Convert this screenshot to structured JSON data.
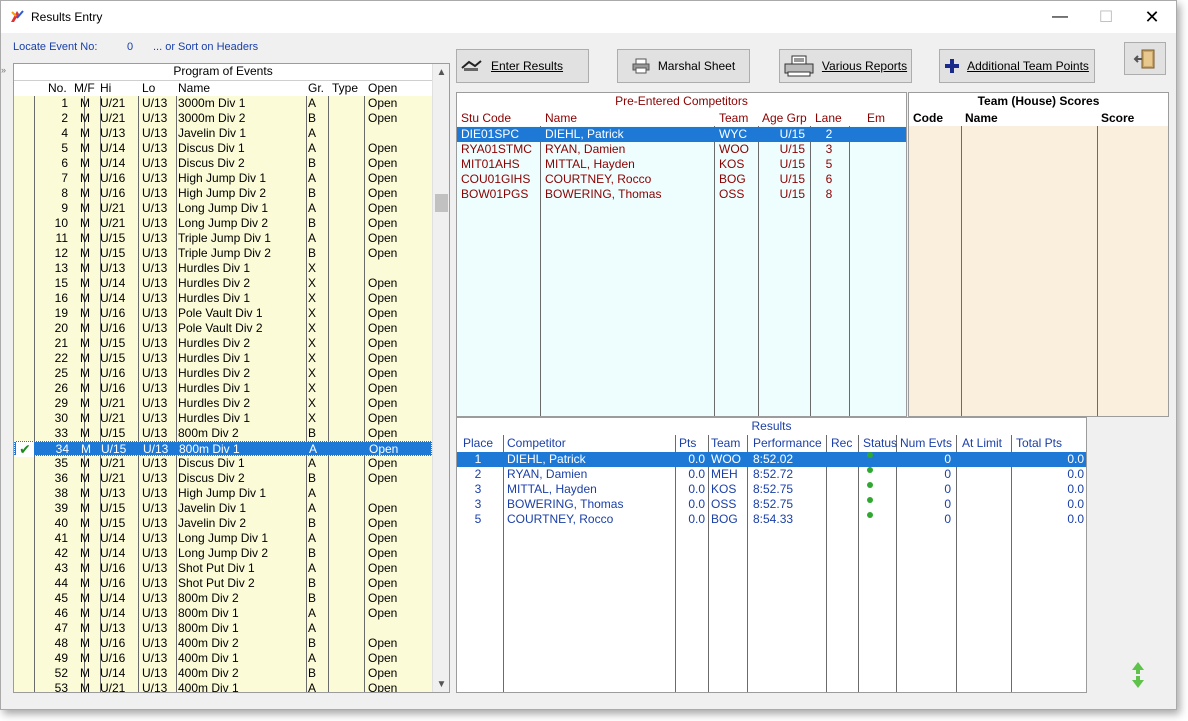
{
  "window": {
    "title": "Results Entry",
    "minimize": "—",
    "maximize": "☐",
    "close": "✕"
  },
  "locate": {
    "label": "Locate Event No:",
    "value": "0",
    "sort_hint": "... or Sort on Headers"
  },
  "program": {
    "title": "Program of Events",
    "headers": {
      "no": "No.",
      "mf": "M/F",
      "hi": "Hi",
      "lo": "Lo",
      "name": "Name",
      "gr": "Gr.",
      "type": "Type",
      "open": "Open"
    },
    "rows": [
      {
        "no": "1",
        "mf": "M",
        "hi": "U/21",
        "lo": "U/13",
        "name": "3000m Div 1",
        "gr": "A",
        "type": "",
        "open": "Open"
      },
      {
        "no": "2",
        "mf": "M",
        "hi": "U/21",
        "lo": "U/13",
        "name": "3000m Div 2",
        "gr": "B",
        "type": "",
        "open": "Open"
      },
      {
        "no": "4",
        "mf": "M",
        "hi": "U/13",
        "lo": "U/13",
        "name": "Javelin Div 1",
        "gr": "A",
        "type": "",
        "open": ""
      },
      {
        "no": "5",
        "mf": "M",
        "hi": "U/14",
        "lo": "U/13",
        "name": "Discus Div 1",
        "gr": "A",
        "type": "",
        "open": "Open"
      },
      {
        "no": "6",
        "mf": "M",
        "hi": "U/14",
        "lo": "U/13",
        "name": "Discus Div 2",
        "gr": "B",
        "type": "",
        "open": "Open"
      },
      {
        "no": "7",
        "mf": "M",
        "hi": "U/16",
        "lo": "U/13",
        "name": "High Jump Div 1",
        "gr": "A",
        "type": "",
        "open": "Open"
      },
      {
        "no": "8",
        "mf": "M",
        "hi": "U/16",
        "lo": "U/13",
        "name": "High Jump Div 2",
        "gr": "B",
        "type": "",
        "open": "Open"
      },
      {
        "no": "9",
        "mf": "M",
        "hi": "U/21",
        "lo": "U/13",
        "name": "Long Jump Div 1",
        "gr": "A",
        "type": "",
        "open": "Open"
      },
      {
        "no": "10",
        "mf": "M",
        "hi": "U/21",
        "lo": "U/13",
        "name": "Long Jump Div 2",
        "gr": "B",
        "type": "",
        "open": "Open"
      },
      {
        "no": "11",
        "mf": "M",
        "hi": "U/15",
        "lo": "U/13",
        "name": "Triple Jump Div 1",
        "gr": "A",
        "type": "",
        "open": "Open"
      },
      {
        "no": "12",
        "mf": "M",
        "hi": "U/15",
        "lo": "U/13",
        "name": "Triple Jump Div 2",
        "gr": "B",
        "type": "",
        "open": "Open"
      },
      {
        "no": "13",
        "mf": "M",
        "hi": "U/13",
        "lo": "U/13",
        "name": "Hurdles Div 1",
        "gr": "X",
        "type": "",
        "open": ""
      },
      {
        "no": "15",
        "mf": "M",
        "hi": "U/14",
        "lo": "U/13",
        "name": "Hurdles Div 2",
        "gr": "X",
        "type": "",
        "open": "Open"
      },
      {
        "no": "16",
        "mf": "M",
        "hi": "U/14",
        "lo": "U/13",
        "name": "Hurdles Div 1",
        "gr": "X",
        "type": "",
        "open": "Open"
      },
      {
        "no": "19",
        "mf": "M",
        "hi": "U/16",
        "lo": "U/13",
        "name": "Pole Vault Div 1",
        "gr": "X",
        "type": "",
        "open": "Open"
      },
      {
        "no": "20",
        "mf": "M",
        "hi": "U/16",
        "lo": "U/13",
        "name": "Pole Vault Div 2",
        "gr": "X",
        "type": "",
        "open": "Open"
      },
      {
        "no": "21",
        "mf": "M",
        "hi": "U/15",
        "lo": "U/13",
        "name": "Hurdles Div 2",
        "gr": "X",
        "type": "",
        "open": "Open"
      },
      {
        "no": "22",
        "mf": "M",
        "hi": "U/15",
        "lo": "U/13",
        "name": "Hurdles Div 1",
        "gr": "X",
        "type": "",
        "open": "Open"
      },
      {
        "no": "25",
        "mf": "M",
        "hi": "U/16",
        "lo": "U/13",
        "name": "Hurdles Div 2",
        "gr": "X",
        "type": "",
        "open": "Open"
      },
      {
        "no": "26",
        "mf": "M",
        "hi": "U/16",
        "lo": "U/13",
        "name": "Hurdles Div 1",
        "gr": "X",
        "type": "",
        "open": "Open"
      },
      {
        "no": "29",
        "mf": "M",
        "hi": "U/21",
        "lo": "U/13",
        "name": "Hurdles Div 2",
        "gr": "X",
        "type": "",
        "open": "Open"
      },
      {
        "no": "30",
        "mf": "M",
        "hi": "U/21",
        "lo": "U/13",
        "name": "Hurdles Div 1",
        "gr": "X",
        "type": "",
        "open": "Open"
      },
      {
        "no": "33",
        "mf": "M",
        "hi": "U/15",
        "lo": "U/13",
        "name": "800m Div 2",
        "gr": "B",
        "type": "",
        "open": "Open"
      },
      {
        "no": "34",
        "mf": "M",
        "hi": "U/15",
        "lo": "U/13",
        "name": "800m Div 1",
        "gr": "A",
        "type": "",
        "open": "Open",
        "selected": true
      },
      {
        "no": "35",
        "mf": "M",
        "hi": "U/21",
        "lo": "U/13",
        "name": "Discus Div 1",
        "gr": "A",
        "type": "",
        "open": "Open"
      },
      {
        "no": "36",
        "mf": "M",
        "hi": "U/21",
        "lo": "U/13",
        "name": "Discus Div 2",
        "gr": "B",
        "type": "",
        "open": "Open"
      },
      {
        "no": "38",
        "mf": "M",
        "hi": "U/13",
        "lo": "U/13",
        "name": "High Jump Div 1",
        "gr": "A",
        "type": "",
        "open": ""
      },
      {
        "no": "39",
        "mf": "M",
        "hi": "U/15",
        "lo": "U/13",
        "name": "Javelin Div 1",
        "gr": "A",
        "type": "",
        "open": "Open"
      },
      {
        "no": "40",
        "mf": "M",
        "hi": "U/15",
        "lo": "U/13",
        "name": "Javelin Div 2",
        "gr": "B",
        "type": "",
        "open": "Open"
      },
      {
        "no": "41",
        "mf": "M",
        "hi": "U/14",
        "lo": "U/13",
        "name": "Long Jump Div 1",
        "gr": "A",
        "type": "",
        "open": "Open"
      },
      {
        "no": "42",
        "mf": "M",
        "hi": "U/14",
        "lo": "U/13",
        "name": "Long Jump Div 2",
        "gr": "B",
        "type": "",
        "open": "Open"
      },
      {
        "no": "43",
        "mf": "M",
        "hi": "U/16",
        "lo": "U/13",
        "name": "Shot Put Div 1",
        "gr": "A",
        "type": "",
        "open": "Open"
      },
      {
        "no": "44",
        "mf": "M",
        "hi": "U/16",
        "lo": "U/13",
        "name": "Shot Put Div 2",
        "gr": "B",
        "type": "",
        "open": "Open"
      },
      {
        "no": "45",
        "mf": "M",
        "hi": "U/14",
        "lo": "U/13",
        "name": "800m Div 2",
        "gr": "B",
        "type": "",
        "open": "Open"
      },
      {
        "no": "46",
        "mf": "M",
        "hi": "U/14",
        "lo": "U/13",
        "name": "800m Div 1",
        "gr": "A",
        "type": "",
        "open": "Open"
      },
      {
        "no": "47",
        "mf": "M",
        "hi": "U/13",
        "lo": "U/13",
        "name": "800m Div 1",
        "gr": "A",
        "type": "",
        "open": ""
      },
      {
        "no": "48",
        "mf": "M",
        "hi": "U/16",
        "lo": "U/13",
        "name": "400m Div 2",
        "gr": "B",
        "type": "",
        "open": "Open"
      },
      {
        "no": "49",
        "mf": "M",
        "hi": "U/16",
        "lo": "U/13",
        "name": "400m Div 1",
        "gr": "A",
        "type": "",
        "open": "Open"
      },
      {
        "no": "52",
        "mf": "M",
        "hi": "U/14",
        "lo": "U/13",
        "name": "400m Div 2",
        "gr": "B",
        "type": "",
        "open": "Open"
      },
      {
        "no": "53",
        "mf": "M",
        "hi": "U/21",
        "lo": "U/13",
        "name": "400m Div 1",
        "gr": "A",
        "type": "",
        "open": "Open"
      }
    ]
  },
  "toolbar": {
    "enter_results": "Enter Results",
    "marshal_sheet": "Marshal Sheet",
    "various_reports": "Various Reports",
    "additional_team_points": "Additional Team Points"
  },
  "pre_entered": {
    "title": "Pre-Entered Competitors",
    "headers": {
      "code": "Stu Code",
      "name": "Name",
      "team": "Team",
      "age": "Age Grp",
      "lane": "Lane",
      "em": "Em"
    },
    "rows": [
      {
        "code": "DIE01SPC",
        "name": "DIEHL, Patrick",
        "team": "WYC",
        "age": "U/15",
        "lane": "2",
        "selected": true
      },
      {
        "code": "RYA01STMC",
        "name": "RYAN, Damien",
        "team": "WOO",
        "age": "U/15",
        "lane": "3"
      },
      {
        "code": "MIT01AHS",
        "name": "MITTAL, Hayden",
        "team": "KOS",
        "age": "U/15",
        "lane": "5"
      },
      {
        "code": "COU01GIHS",
        "name": "COURTNEY, Rocco",
        "team": "BOG",
        "age": "U/15",
        "lane": "6"
      },
      {
        "code": "BOW01PGS",
        "name": "BOWERING, Thomas",
        "team": "OSS",
        "age": "U/15",
        "lane": "8"
      }
    ]
  },
  "team_scores": {
    "title": "Team (House) Scores",
    "headers": {
      "code": "Code",
      "name": "Name",
      "score": "Score"
    }
  },
  "results": {
    "title": "Results",
    "headers": {
      "place": "Place",
      "competitor": "Competitor",
      "pts": "Pts",
      "team": "Team",
      "performance": "Performance",
      "rec": "Rec",
      "status": "Status",
      "num_evts": "Num Evts",
      "at_limit": "At Limit",
      "total_pts": "Total Pts"
    },
    "rows": [
      {
        "place": "1",
        "competitor": "DIEHL, Patrick",
        "pts": "0.0",
        "team": "WOO",
        "performance": "8:52.02",
        "num_evts": "0",
        "total_pts": "0.0",
        "selected": true
      },
      {
        "place": "2",
        "competitor": "RYAN, Damien",
        "pts": "0.0",
        "team": "MEH",
        "performance": "8:52.72",
        "num_evts": "0",
        "total_pts": "0.0"
      },
      {
        "place": "3",
        "competitor": "MITTAL, Hayden",
        "pts": "0.0",
        "team": "KOS",
        "performance": "8:52.75",
        "num_evts": "0",
        "total_pts": "0.0"
      },
      {
        "place": "3",
        "competitor": "BOWERING, Thomas",
        "pts": "0.0",
        "team": "OSS",
        "performance": "8:52.75",
        "num_evts": "0",
        "total_pts": "0.0"
      },
      {
        "place": "5",
        "competitor": "COURTNEY, Rocco",
        "pts": "0.0",
        "team": "BOG",
        "performance": "8:54.33",
        "num_evts": "0",
        "total_pts": "0.0"
      }
    ]
  },
  "colors": {
    "selection": "#1e79d6",
    "program_bg": "#fbfbd7",
    "pre_bg": "#eefefe",
    "team_bg": "#faeedd",
    "pre_text": "#8b0000",
    "results_text": "#1a3fa8"
  }
}
